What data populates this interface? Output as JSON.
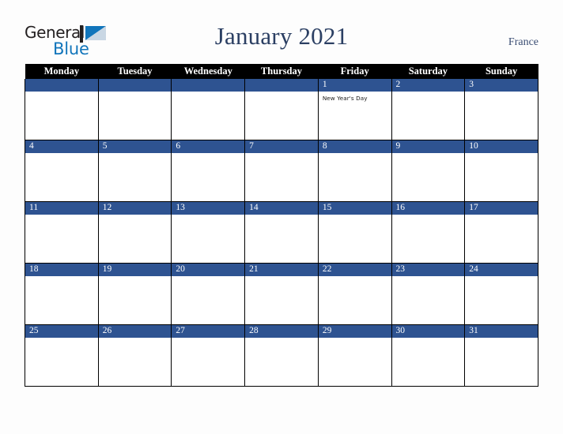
{
  "brand": {
    "line1": "General",
    "line2": "Blue",
    "mark": "triangle-logo",
    "color_dark": "#231f20",
    "color_blue": "#1175bb"
  },
  "header": {
    "title": "January 2021",
    "country": "France",
    "title_color": "#2b3f63"
  },
  "calendar": {
    "weekday_headers": [
      "Monday",
      "Tuesday",
      "Wednesday",
      "Thursday",
      "Friday",
      "Saturday",
      "Sunday"
    ],
    "header_bg": "#000000",
    "daybar_bg": "#2e5391",
    "weeks": [
      [
        {
          "date": "",
          "event": ""
        },
        {
          "date": "",
          "event": ""
        },
        {
          "date": "",
          "event": ""
        },
        {
          "date": "",
          "event": ""
        },
        {
          "date": "1",
          "event": "New Year's Day"
        },
        {
          "date": "2",
          "event": ""
        },
        {
          "date": "3",
          "event": ""
        }
      ],
      [
        {
          "date": "4",
          "event": ""
        },
        {
          "date": "5",
          "event": ""
        },
        {
          "date": "6",
          "event": ""
        },
        {
          "date": "7",
          "event": ""
        },
        {
          "date": "8",
          "event": ""
        },
        {
          "date": "9",
          "event": ""
        },
        {
          "date": "10",
          "event": ""
        }
      ],
      [
        {
          "date": "11",
          "event": ""
        },
        {
          "date": "12",
          "event": ""
        },
        {
          "date": "13",
          "event": ""
        },
        {
          "date": "14",
          "event": ""
        },
        {
          "date": "15",
          "event": ""
        },
        {
          "date": "16",
          "event": ""
        },
        {
          "date": "17",
          "event": ""
        }
      ],
      [
        {
          "date": "18",
          "event": ""
        },
        {
          "date": "19",
          "event": ""
        },
        {
          "date": "20",
          "event": ""
        },
        {
          "date": "21",
          "event": ""
        },
        {
          "date": "22",
          "event": ""
        },
        {
          "date": "23",
          "event": ""
        },
        {
          "date": "24",
          "event": ""
        }
      ],
      [
        {
          "date": "25",
          "event": ""
        },
        {
          "date": "26",
          "event": ""
        },
        {
          "date": "27",
          "event": ""
        },
        {
          "date": "28",
          "event": ""
        },
        {
          "date": "29",
          "event": ""
        },
        {
          "date": "30",
          "event": ""
        },
        {
          "date": "31",
          "event": ""
        }
      ]
    ]
  }
}
